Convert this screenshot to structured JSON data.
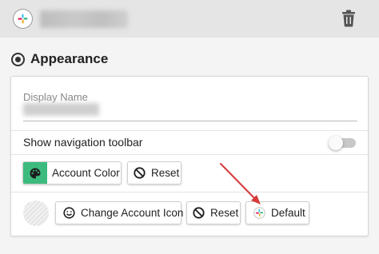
{
  "header": {
    "app_icon": "slack-icon",
    "account_name_visible": false,
    "delete_icon": "trash-icon"
  },
  "section": {
    "title": "Appearance",
    "icon": "radio-selected-icon"
  },
  "display_name": {
    "label": "Display Name",
    "value_blurred": true
  },
  "navigation_toolbar": {
    "label": "Show navigation toolbar",
    "enabled": false
  },
  "account_color": {
    "button_label": "Account Color",
    "swatch_color": "#3dba7e",
    "palette_icon": "palette-icon",
    "reset_label": "Reset",
    "reset_icon": "block-icon"
  },
  "account_icon": {
    "avatar_placeholder": "striped-avatar",
    "change_label": "Change Account Icon",
    "change_icon": "smiley-icon",
    "reset_label": "Reset",
    "reset_icon": "block-icon",
    "default_label": "Default",
    "default_icon": "slack-icon"
  },
  "annotation": {
    "arrow_color": "#d63a3a",
    "target": "default-button"
  }
}
